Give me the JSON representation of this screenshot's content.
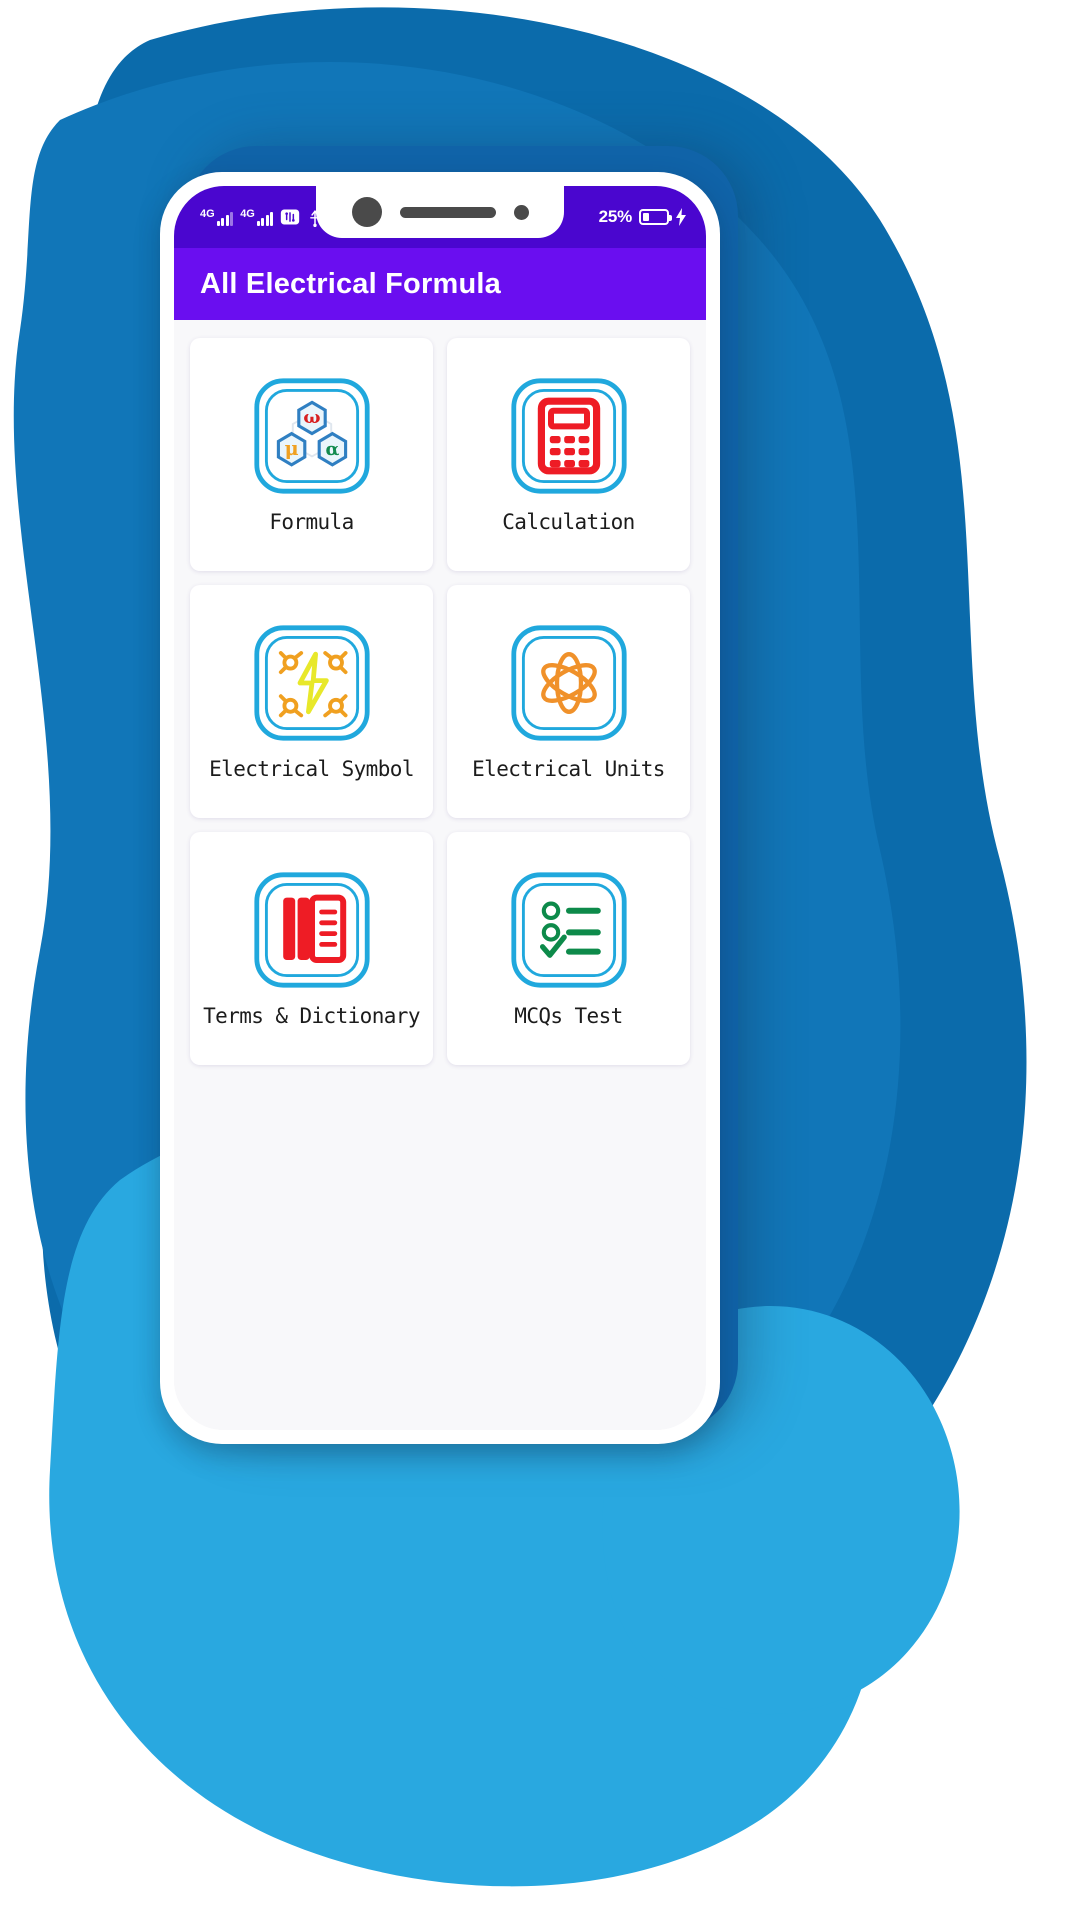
{
  "statusbar": {
    "network_primary": "4G",
    "network_secondary": "4G",
    "icons": [
      "signal-4g-sim1",
      "signal-4g-sim2",
      "usb-debugging-icon",
      "usb-icon",
      "do-not-disturb-icon",
      "more-icon"
    ],
    "battery_percent": "25%",
    "battery_level": 25,
    "charging": true
  },
  "appbar": {
    "title": "All Electrical Formula",
    "background": "#6a0ef0"
  },
  "grid": {
    "items": [
      {
        "label": "Formula",
        "icon": "formula-hexagons-icon",
        "symbols": [
          "ω",
          "μ",
          "α"
        ],
        "accent": "#d81f1f"
      },
      {
        "label": "Calculation",
        "icon": "calculator-icon",
        "accent": "#ee1c25"
      },
      {
        "label": "Electrical Symbol",
        "icon": "plug-lightning-icon",
        "accent": "#f0a020"
      },
      {
        "label": "Electrical Units",
        "icon": "atom-icon",
        "accent": "#f0912a"
      },
      {
        "label": "Terms & Dictionary",
        "icon": "documents-icon",
        "accent": "#ee1c25"
      },
      {
        "label": "MCQs Test",
        "icon": "checklist-icon",
        "accent": "#0d8a4a"
      }
    ]
  },
  "navbar": {
    "items": [
      {
        "name": "recent-apps-button",
        "icon": "menu-icon"
      },
      {
        "name": "home-button",
        "icon": "home-icon"
      },
      {
        "name": "back-button",
        "icon": "back-icon"
      }
    ]
  },
  "theme": {
    "status_bar": "#4a06cf",
    "app_bar": "#6a0ef0",
    "icon_frame": "#20a8dd",
    "page_bg": "#f8f8fa",
    "blob_dark": "#0b6bab",
    "blob_mid": "#1176b8",
    "blob_light": "#29a8e0"
  }
}
